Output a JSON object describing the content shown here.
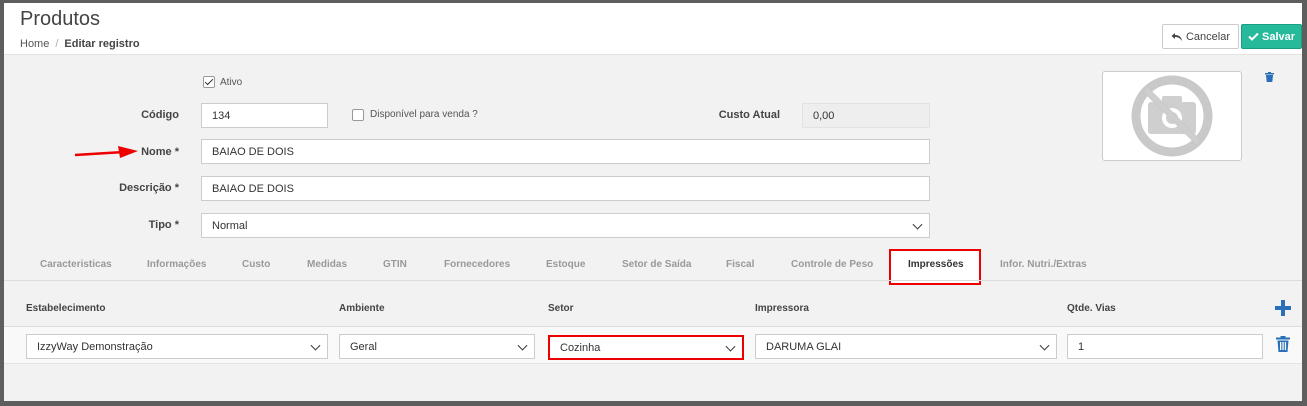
{
  "header": {
    "title": "Produtos",
    "breadcrumb": {
      "home": "Home",
      "separator": "/",
      "current": "Editar registro"
    },
    "buttons": {
      "cancel": "Cancelar",
      "save": "Salvar"
    }
  },
  "form": {
    "ativo_label": "Ativo",
    "ativo_checked": true,
    "codigo_label": "Código",
    "codigo_value": "134",
    "disponivel_label": "Disponível para venda ?",
    "disponivel_checked": false,
    "custo_label": "Custo Atual",
    "custo_value": "0,00",
    "nome_label": "Nome *",
    "nome_value": "BAIAO DE DOIS",
    "descricao_label": "Descrição *",
    "descricao_value": "BAIAO DE DOIS",
    "tipo_label": "Tipo *",
    "tipo_value": "Normal"
  },
  "tabs": [
    {
      "label": "Caracteristicas"
    },
    {
      "label": "Informações"
    },
    {
      "label": "Custo"
    },
    {
      "label": "Medidas"
    },
    {
      "label": "GTIN"
    },
    {
      "label": "Fornecedores"
    },
    {
      "label": "Estoque"
    },
    {
      "label": "Setor de Saída"
    },
    {
      "label": "Fiscal"
    },
    {
      "label": "Controle de Peso"
    },
    {
      "label": "Impressões",
      "active": true
    },
    {
      "label": "Infor. Nutri./Extras"
    }
  ],
  "impressoes": {
    "columns": [
      "Estabelecimento",
      "Ambiente",
      "Setor",
      "Impressora",
      "Qtde. Vias"
    ],
    "rows": [
      {
        "estabelecimento": "IzzyWay Demonstração",
        "ambiente": "Geral",
        "setor": "Cozinha",
        "impressora": "DARUMA GLAI",
        "vias": "1"
      }
    ]
  },
  "colors": {
    "accent": "#26b99a",
    "highlight": "#e00000",
    "link": "#2a6fb7"
  }
}
